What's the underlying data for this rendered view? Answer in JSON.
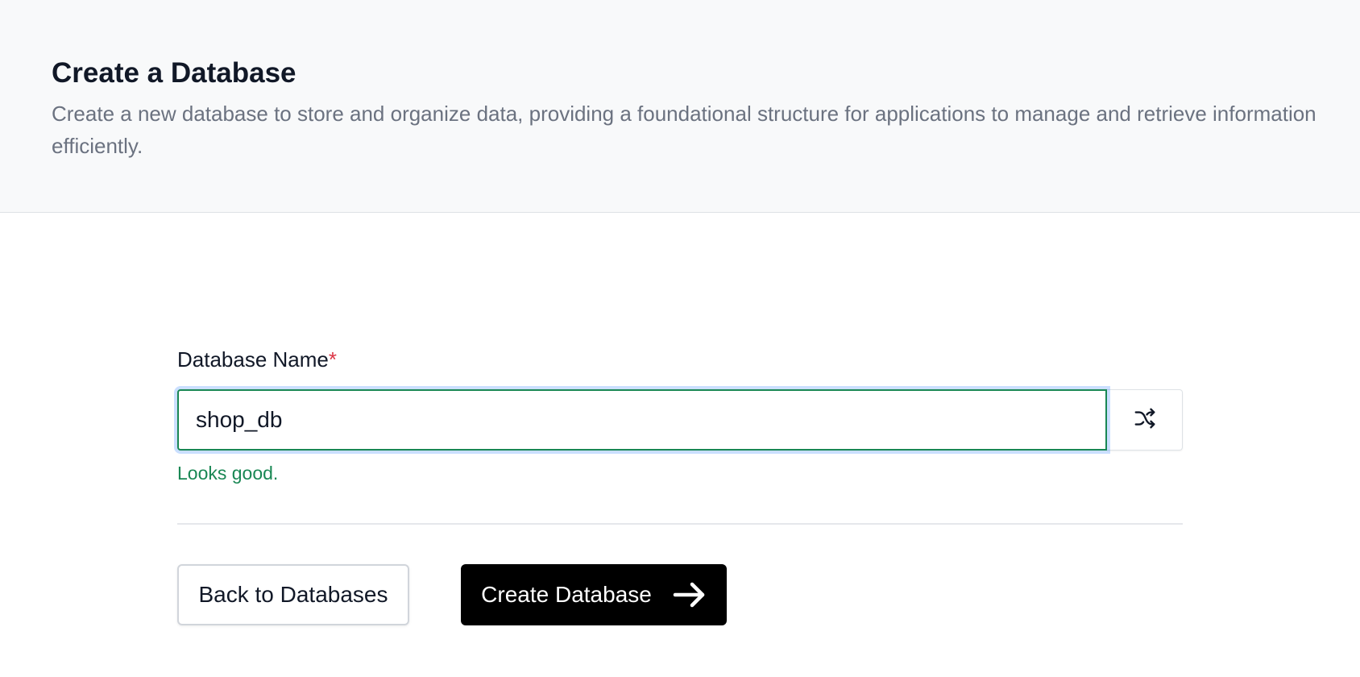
{
  "header": {
    "title": "Create a Database",
    "description": "Create a new database to store and organize data, providing a foundational structure for applications to manage and retrieve information efficiently."
  },
  "form": {
    "name_label": "Database Name",
    "required_marker": "*",
    "name_value": "shop_db",
    "shuffle_icon": "shuffle-icon",
    "validation_message": "Looks good.",
    "validation_color": "#198754"
  },
  "actions": {
    "back_label": "Back to Databases",
    "create_label": "Create Database",
    "create_icon": "arrow-right-icon",
    "create_bg": "#000000"
  }
}
